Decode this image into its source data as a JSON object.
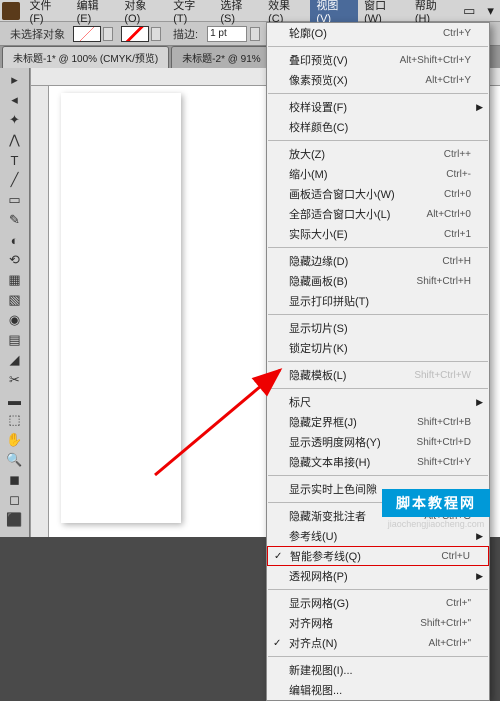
{
  "menubar": {
    "items": [
      "文件(F)",
      "编辑(E)",
      "对象(O)",
      "文字(T)",
      "选择(S)",
      "效果(C)",
      "视图(V)",
      "窗口(W)",
      "帮助(H)"
    ]
  },
  "optionsbar": {
    "status": "未选择对象",
    "stroke_label": "描边:",
    "stroke_value": "1 pt"
  },
  "tabs": {
    "t1": "未标题-1* @ 100% (CMYK/预览)",
    "t2": "未标题-2* @ 91%"
  },
  "menu": {
    "g1": [
      {
        "l": "轮廓(O)",
        "s": "Ctrl+Y"
      }
    ],
    "g2": [
      {
        "l": "叠印预览(V)",
        "s": "Alt+Shift+Ctrl+Y"
      },
      {
        "l": "像素预览(X)",
        "s": "Alt+Ctrl+Y"
      }
    ],
    "g3": [
      {
        "l": "校样设置(F)",
        "sub": true
      },
      {
        "l": "校样颜色(C)"
      }
    ],
    "g4": [
      {
        "l": "放大(Z)",
        "s": "Ctrl++"
      },
      {
        "l": "缩小(M)",
        "s": "Ctrl+-"
      },
      {
        "l": "画板适合窗口大小(W)",
        "s": "Ctrl+0"
      },
      {
        "l": "全部适合窗口大小(L)",
        "s": "Alt+Ctrl+0"
      },
      {
        "l": "实际大小(E)",
        "s": "Ctrl+1"
      }
    ],
    "g5": [
      {
        "l": "隐藏边缘(D)",
        "s": "Ctrl+H"
      },
      {
        "l": "隐藏画板(B)",
        "s": "Shift+Ctrl+H"
      },
      {
        "l": "显示打印拼贴(T)"
      }
    ],
    "g6": [
      {
        "l": "显示切片(S)"
      },
      {
        "l": "锁定切片(K)"
      }
    ],
    "g7": [
      {
        "l": "隐藏模板(L)",
        "s": "Shift+Ctrl+W",
        "dis": true
      }
    ],
    "g8": [
      {
        "l": "标尺",
        "sub": true
      },
      {
        "l": "隐藏定界框(J)",
        "s": "Shift+Ctrl+B"
      },
      {
        "l": "显示透明度网格(Y)",
        "s": "Shift+Ctrl+D"
      },
      {
        "l": "隐藏文本串接(H)",
        "s": "Shift+Ctrl+Y"
      }
    ],
    "g9": [
      {
        "l": "显示实时上色间隙"
      }
    ],
    "g10": [
      {
        "l": "隐藏渐变批注者",
        "s": "Alt+Ctrl+G"
      },
      {
        "l": "参考线(U)",
        "sub": true
      },
      {
        "l": "智能参考线(Q)",
        "s": "Ctrl+U",
        "chk": true,
        "hl": true
      },
      {
        "l": "透视网格(P)",
        "sub": true
      }
    ],
    "g11": [
      {
        "l": "显示网格(G)",
        "s": "Ctrl+\""
      },
      {
        "l": "对齐网格",
        "s": "Shift+Ctrl+\""
      },
      {
        "l": "对齐点(N)",
        "s": "Alt+Ctrl+\"",
        "chk": true
      }
    ],
    "g12": [
      {
        "l": "新建视图(I)..."
      },
      {
        "l": "编辑视图..."
      }
    ]
  },
  "tools": [
    "▸",
    "◂",
    "✦",
    "⋀",
    "T",
    "╱",
    "▭",
    "✎",
    "◐",
    "⟲",
    "▦",
    "▧",
    "◉",
    "▤",
    "◢",
    "✂",
    "▬",
    "⬚",
    "✋",
    "🔍",
    "◼",
    "◻",
    "⬛"
  ],
  "watermark": {
    "t1": "脚本教程网",
    "t2": "jiaochengjiaocheng.com"
  }
}
